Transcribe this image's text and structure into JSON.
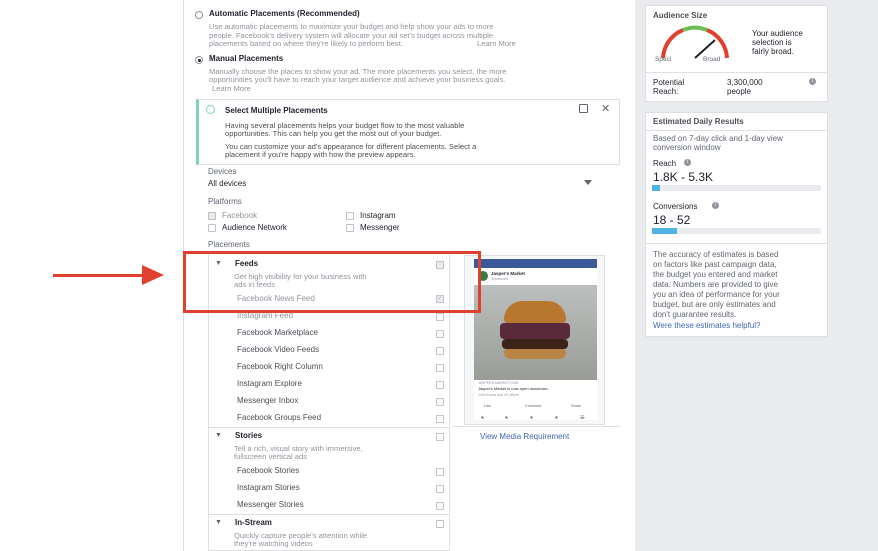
{
  "placements": {
    "auto": {
      "title": "Automatic Placements (Recommended)",
      "desc1": "Use automatic placements to maximize your budget and help show your ads to more",
      "desc2": "people. Facebook's delivery system will allocate your ad set's budget across multiple",
      "desc3": "placements based on where they're likely to perform best.",
      "link": "Learn More"
    },
    "manual": {
      "title": "Manual Placements",
      "desc1": "Manually choose the places to show your ad. The more placements you select, the more",
      "desc2": "opportunities you'll have to reach your target audience and achieve your business goals.",
      "link": "Learn More"
    }
  },
  "tip": {
    "title": "Select Multiple Placements",
    "p1a": "Having several placements helps your budget flow to the most valuable",
    "p1b": "opportunities. This can help you get the most out of your budget.",
    "p2a": "You can customize your ad's appearance for different placements. Select a",
    "p2b": "placement if you're happy with how the preview appears."
  },
  "devices": {
    "label": "Devices",
    "value": "All devices"
  },
  "platforms": {
    "label": "Platforms",
    "facebook": "Facebook",
    "instagram": "Instagram",
    "audience_network": "Audience Network",
    "messenger": "Messenger"
  },
  "placements_label": "Placements",
  "feeds": {
    "title": "Feeds",
    "desc1": "Get high visibility for your business with",
    "desc2": "ads in feeds",
    "items": [
      "Facebook News Feed",
      "Instagram Feed",
      "Facebook Marketplace",
      "Facebook Video Feeds",
      "Facebook Right Column",
      "Instagram Explore",
      "Messenger Inbox",
      "Facebook Groups Feed"
    ]
  },
  "stories": {
    "title": "Stories",
    "desc1": "Tell a rich, visual story with immersive,",
    "desc2": "fullscreen vertical ads",
    "items": [
      "Facebook Stories",
      "Instagram Stories",
      "Messenger Stories"
    ]
  },
  "instream": {
    "title": "In-Stream",
    "desc1": "Quickly capture people's attention while",
    "desc2": "they're watching videos"
  },
  "preview": {
    "page_name": "Jasper's Market",
    "sponsored": "Sponsored",
    "url": "JASPERS-MARKET.COM",
    "headline": "Jasper's Market is now open downtown",
    "reactions": "John Evans and 29 others",
    "like": "Like",
    "comment": "Comment",
    "share": "Share",
    "link": "View Media Requirement"
  },
  "audience": {
    "title": "Audience Size",
    "specific": "Speci",
    "broad": "Broad",
    "summary1": "Your audience",
    "summary2": "selection is",
    "summary3": "fairly broad.",
    "reach_label1": "Potential",
    "reach_label2": "Reach:",
    "reach_value1": "3,300,000",
    "reach_value2": "people"
  },
  "results": {
    "title": "Estimated Daily Results",
    "basis1": "Based on 7-day click and 1-day view",
    "basis2": "conversion window",
    "reach_label": "Reach",
    "reach_value": "1.8K - 5.3K",
    "conv_label": "Conversions",
    "conv_value": "18 - 52",
    "note1": "The accuracy of estimates is based",
    "note2": "on factors like past campaign data,",
    "note3": "the budget you entered and market",
    "note4": "data. Numbers are provided to give",
    "note5": "you an idea of performance for your",
    "note6": "budget, but are only estimates and",
    "note7": "don't guarantee results.",
    "helpful": "Were these estimates helpful?",
    "reach_fill": 0.05,
    "conv_fill": 0.15
  },
  "colors": {
    "accent": "#4267b2",
    "annotation": "#e0412f",
    "tip_border": "#7fd3b7",
    "bar_fill": "#4fb3e3"
  }
}
